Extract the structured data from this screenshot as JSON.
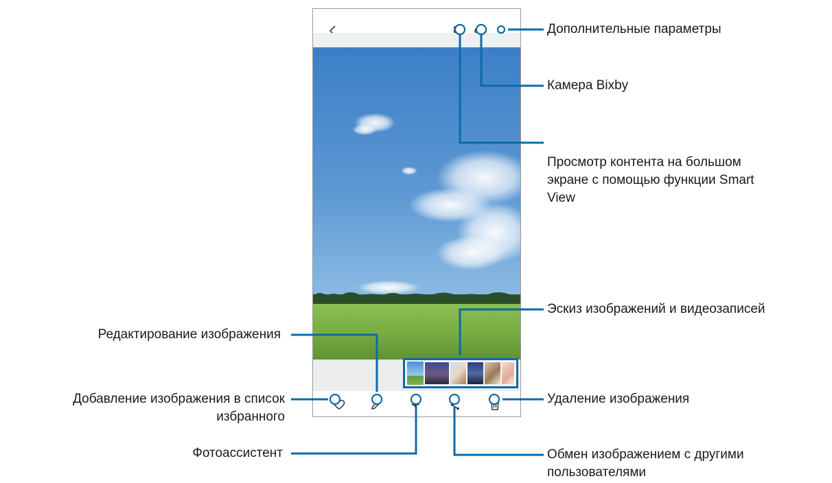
{
  "callouts": {
    "more_options": "Дополнительные параметры",
    "bixby_camera": "Камера Bixby",
    "smart_view_line1": "Просмотр контента на большом",
    "smart_view_line2": "экране с помощью функции Smart",
    "smart_view_line3": "View",
    "thumbnails": "Эскиз изображений и видеозаписей",
    "edit_image": "Редактирование изображения",
    "add_favorite_line1": "Добавление изображения в список",
    "add_favorite_line2": "избранного",
    "delete_image": "Удаление изображения",
    "photo_assistant": "Фотоассистент",
    "share_line1": "Обмен изображением с другими",
    "share_line2": "пользователями"
  },
  "icons": {
    "back": "chevron-left-icon",
    "smart_view": "smart-view-icon",
    "bixby": "eye-icon",
    "more": "more-vertical-icon",
    "favorite": "heart-icon",
    "edit": "pencil-icon",
    "assistant": "sparkle-icon",
    "share": "share-icon",
    "delete": "trash-icon"
  },
  "colors": {
    "callout_line": "#0d6aa8",
    "thumbnail_highlight": "#0d6aa8"
  }
}
